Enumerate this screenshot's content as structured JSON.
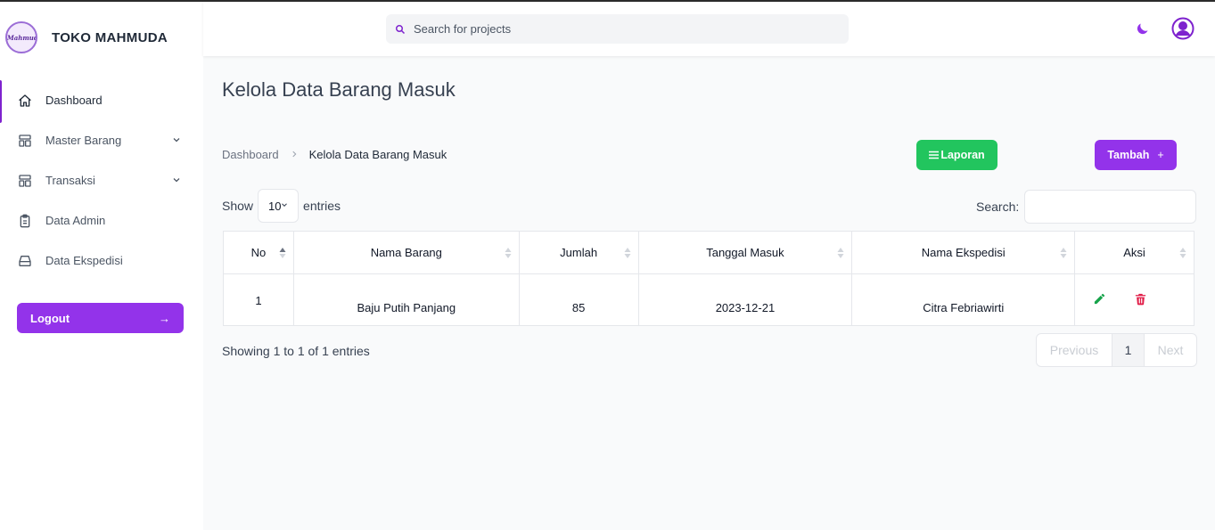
{
  "brand": {
    "logo_text": "Mahmuda",
    "name": "TOKO MAHMUDA"
  },
  "sidebar": {
    "items": [
      {
        "label": "Dashboard",
        "icon": "home-icon",
        "active": true
      },
      {
        "label": "Master Barang",
        "icon": "template-icon",
        "has_submenu": true
      },
      {
        "label": "Transaksi",
        "icon": "template-icon",
        "has_submenu": true
      },
      {
        "label": "Data Admin",
        "icon": "clipboard-icon"
      },
      {
        "label": "Data Ekspedisi",
        "icon": "inbox-icon"
      }
    ],
    "logout_label": "Logout",
    "logout_arrow": "→"
  },
  "header": {
    "search_placeholder": "Search for projects"
  },
  "main": {
    "title": "Kelola Data Barang Masuk",
    "breadcrumb": {
      "home": "Dashboard",
      "current": "Kelola Data Barang Masuk"
    },
    "laporan_label": "Laporan",
    "tambah_label": "Tambah",
    "tambah_plus": "+",
    "show_label": "Show",
    "entries_value": "10",
    "entries_label": "entries",
    "search_label": "Search:"
  },
  "table": {
    "columns": [
      "No",
      "Nama Barang",
      "Jumlah",
      "Tanggal Masuk",
      "Nama Ekspedisi",
      "Aksi"
    ],
    "rows": [
      {
        "no": "1",
        "nama_barang": "Baju Putih Panjang",
        "jumlah": "85",
        "tanggal_masuk": "2023-12-21",
        "nama_ekspedisi": "Citra Febriawirti"
      }
    ]
  },
  "footer": {
    "info": "Showing 1 to 1 of 1 entries",
    "prev": "Previous",
    "page": "1",
    "next": "Next"
  },
  "colors": {
    "accent": "#9333ea",
    "success": "#22c55e",
    "danger": "#e11d48",
    "edit": "#16a34a"
  }
}
